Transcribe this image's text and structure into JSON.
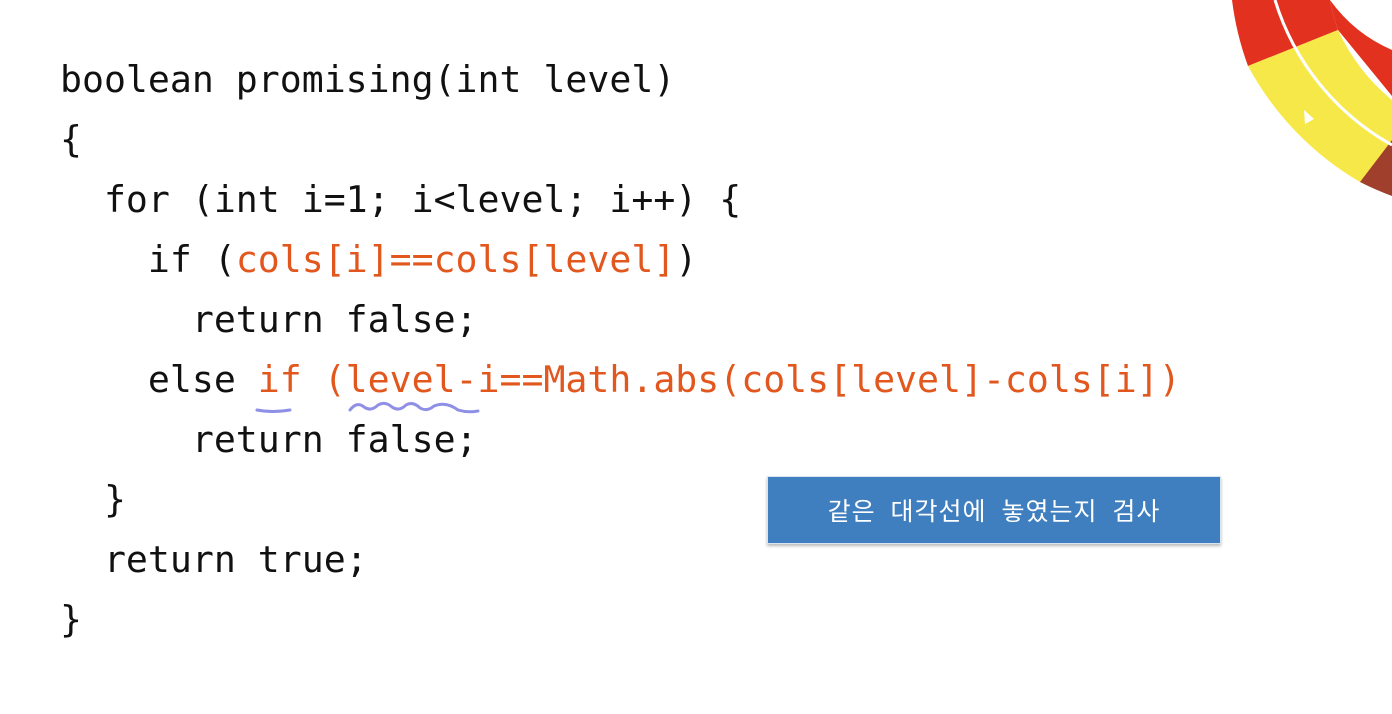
{
  "code": {
    "line1": "boolean promising(int level)",
    "line2": "{",
    "line3": "  for (int i=1; i<level; i++) {",
    "line4_kw": "    if (",
    "line4_expr": "cols[i]==cols[level]",
    "line4_end": ")",
    "line5": "      return false;",
    "line6_kw": "    else ",
    "line6_expr": "if (level-i==Math.abs(cols[level]-cols[i])",
    "line7": "      return false;",
    "line8": "  }",
    "line9": "  return true;",
    "line10": "}"
  },
  "callout": {
    "text": "같은 대각선에 놓였는지 검사"
  },
  "colors": {
    "code_text": "#111111",
    "highlight": "#e2571e",
    "annotation_ink": "#8f8fe6",
    "callout_bg": "#3f7fbf",
    "ring_red": "#e3311f",
    "ring_yellow": "#f7e84a",
    "ring_brown": "#a0402c"
  }
}
